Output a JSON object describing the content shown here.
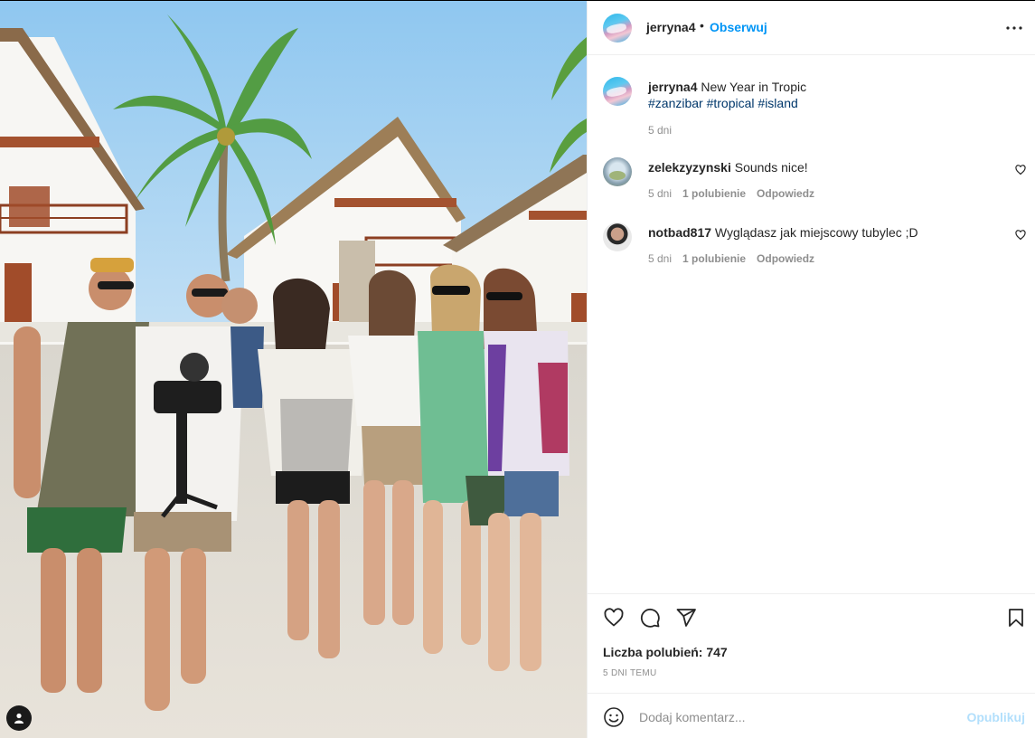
{
  "post": {
    "author": "jerryna4",
    "separator": "•",
    "follow_label": "Obserwuj",
    "more_icon": "more-options-icon"
  },
  "caption": {
    "username": "jerryna4",
    "text": "New Year in Tropic",
    "hashtags": [
      "#zanzibar",
      "#tropical",
      "#island"
    ],
    "time": "5 dni"
  },
  "comments": [
    {
      "username": "zelekzyzynski",
      "text": "Sounds nice!",
      "time": "5 dni",
      "likes": "1 polubienie",
      "reply": "Odpowiedz"
    },
    {
      "username": "notbad817",
      "text": "Wyglądasz jak miejscowy tubylec ;D",
      "time": "5 dni",
      "likes": "1 polubienie",
      "reply": "Odpowiedz"
    }
  ],
  "stats": {
    "likes_label": "Liczba polubień: 747",
    "date": "5 DNI TEMU"
  },
  "composer": {
    "placeholder": "Dodaj komentarz...",
    "publish_label": "Opublikuj"
  },
  "colors": {
    "accent": "#0095f6",
    "hashtag": "#00376b",
    "muted": "#8e8e8e",
    "publish_disabled": "#b2dffc"
  }
}
